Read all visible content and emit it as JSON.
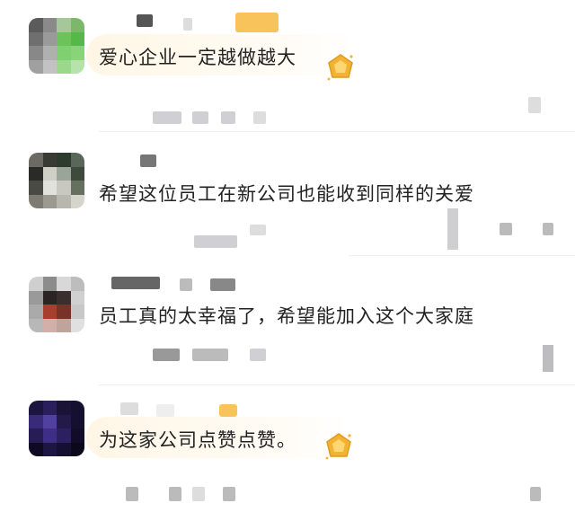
{
  "comments": [
    {
      "text": "爱心企业一定越做越大",
      "has_badge": true,
      "has_medal": true
    },
    {
      "text": "希望这位员工在新公司也能收到同样的关爱",
      "has_badge": false,
      "has_medal": false
    },
    {
      "text": "员工真的太幸福了，希望能加入这个大家庭",
      "has_badge": false,
      "has_medal": false
    },
    {
      "text": "为这家公司点赞点赞。",
      "has_badge": true,
      "has_medal": true
    }
  ],
  "icons": {
    "medal": "gold-medal-icon",
    "avatar": "pixelated-avatar"
  },
  "colors": {
    "badge": "#f7c35a",
    "bubble": "#fff6e6",
    "medal": "#f2b233",
    "text": "#222222"
  }
}
